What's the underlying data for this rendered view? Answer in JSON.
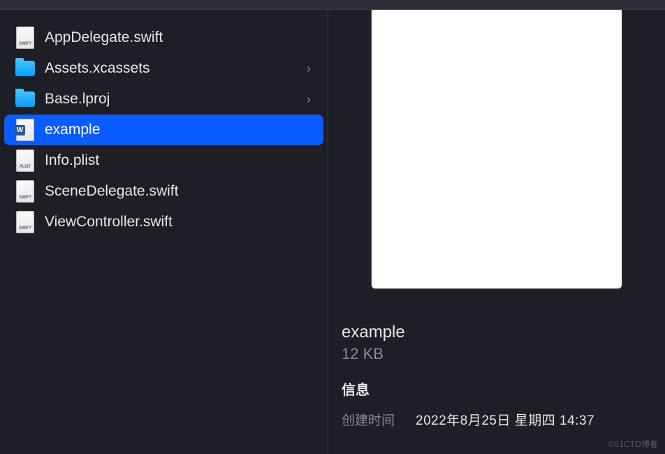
{
  "files": [
    {
      "name": "AppDelegate.swift",
      "icon": "swift",
      "hasChildren": false,
      "selected": false
    },
    {
      "name": "Assets.xcassets",
      "icon": "folder",
      "hasChildren": true,
      "selected": false
    },
    {
      "name": "Base.lproj",
      "icon": "folder",
      "hasChildren": true,
      "selected": false
    },
    {
      "name": "example",
      "icon": "word",
      "hasChildren": false,
      "selected": true
    },
    {
      "name": "Info.plist",
      "icon": "plist",
      "hasChildren": false,
      "selected": false
    },
    {
      "name": "SceneDelegate.swift",
      "icon": "swift",
      "hasChildren": false,
      "selected": false
    },
    {
      "name": "ViewController.swift",
      "icon": "swift",
      "hasChildren": false,
      "selected": false
    }
  ],
  "preview": {
    "title": "example",
    "size": "12 KB",
    "info_heading": "信息",
    "created_label": "创建时间",
    "created_value": "2022年8月25日 星期四 14:37"
  },
  "chevron_glyph": "›",
  "watermark": "©51CTO博客",
  "icon_badges": {
    "swift": "SWIFT",
    "plist": "PLIST"
  }
}
